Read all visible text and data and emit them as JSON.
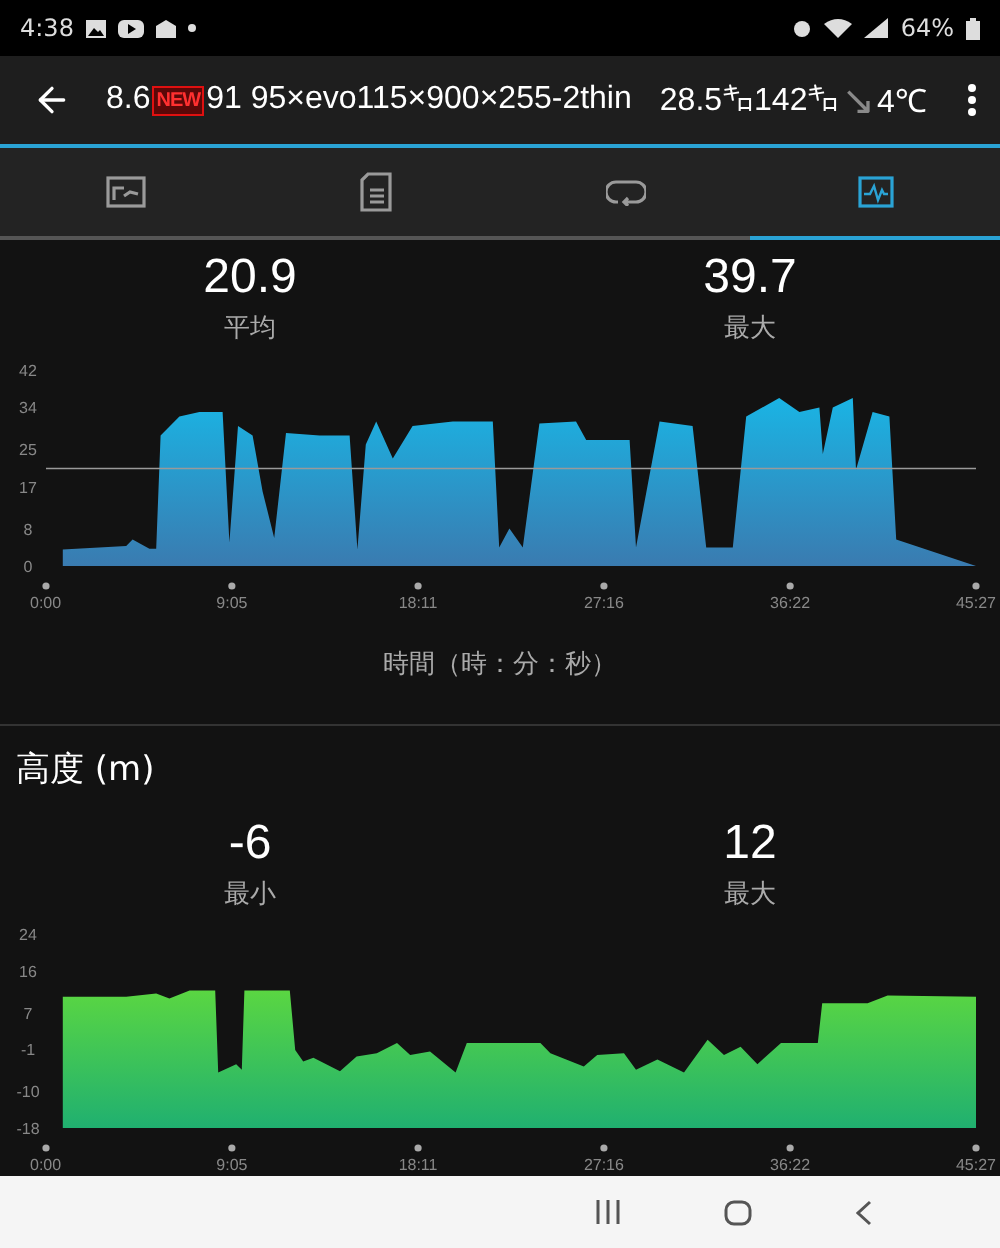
{
  "status_bar": {
    "time": "4:38",
    "battery": "64%"
  },
  "app_bar": {
    "title": [
      {
        "kind": "text",
        "text": "8.6"
      },
      {
        "kind": "badge",
        "text": "NEW"
      },
      {
        "kind": "text",
        "text": "91 95×evo115×900×255-2thin"
      },
      {
        "kind": "text",
        "text": "28.5㌔142㌔"
      },
      {
        "kind": "arrow",
        "text": "↘"
      },
      {
        "kind": "text",
        "text": "4℃"
      }
    ]
  },
  "tabs": [
    {
      "selected": false
    },
    {
      "selected": false
    },
    {
      "selected": false
    },
    {
      "selected": true
    }
  ],
  "speed": {
    "stats": [
      {
        "value": "20.9",
        "label": "平均"
      },
      {
        "value": "39.7",
        "label": "最大"
      }
    ],
    "chart_data": {
      "type": "area",
      "xlabel": "時間（時：分：秒）",
      "xlim": [
        0,
        2727
      ],
      "ylim": [
        0,
        42
      ],
      "yticks": [
        0,
        8,
        17,
        25,
        34,
        42
      ],
      "xticks": [
        {
          "value": 0,
          "label": "0:00"
        },
        {
          "value": 545,
          "label": "9:05"
        },
        {
          "value": 1091,
          "label": "18:11"
        },
        {
          "value": 1636,
          "label": "27:16"
        },
        {
          "value": 2182,
          "label": "36:22"
        },
        {
          "value": 2727,
          "label": "45:27"
        }
      ],
      "x": [
        49,
        235,
        254,
        303,
        323,
        336,
        391,
        450,
        518,
        538,
        563,
        606,
        635,
        669,
        704,
        802,
        890,
        913,
        938,
        968,
        1017,
        1075,
        1193,
        1310,
        1329,
        1359,
        1398,
        1447,
        1554,
        1584,
        1711,
        1730,
        1799,
        1896,
        1936,
        2014,
        2053,
        2150,
        2209,
        2268,
        2278,
        2307,
        2366,
        2375,
        2424,
        2473,
        2493,
        2727
      ],
      "series": [
        {
          "color": "#1ab4e4",
          "values": [
            3.5,
            4.3,
            5.7,
            3.7,
            3.7,
            28,
            32,
            33,
            33,
            5,
            30,
            28,
            16,
            6,
            28.5,
            28,
            28,
            3.5,
            26,
            31,
            23,
            30,
            31,
            31,
            4,
            8,
            4,
            30.5,
            31,
            27,
            27,
            4,
            31,
            30,
            4,
            4,
            32,
            36,
            33,
            34,
            24,
            34,
            36,
            20.6,
            33,
            32,
            5.7,
            0
          ]
        }
      ],
      "ref_lines": [
        {
          "axis": "y",
          "value": 20.9
        }
      ]
    }
  },
  "altitude": {
    "heading": "高度 (m)",
    "stats": [
      {
        "value": "-6",
        "label": "最小"
      },
      {
        "value": "12",
        "label": "最大"
      }
    ],
    "chart_data": {
      "type": "area",
      "xlim": [
        0,
        2727
      ],
      "ylim": [
        -18,
        24
      ],
      "yticks": [
        24,
        16,
        7,
        -1,
        -10,
        -18
      ],
      "xticks": [
        {
          "value": 0,
          "label": "0:00"
        },
        {
          "value": 545,
          "label": "9:05"
        },
        {
          "value": 1091,
          "label": "18:11"
        },
        {
          "value": 1636,
          "label": "27:16"
        },
        {
          "value": 2182,
          "label": "36:22"
        },
        {
          "value": 2727,
          "label": "45:27"
        }
      ],
      "x": [
        49,
        49,
        235,
        323,
        362,
        421,
        496,
        505,
        558,
        574,
        582,
        715,
        731,
        754,
        784,
        862,
        911,
        970,
        1029,
        1068,
        1126,
        1201,
        1234,
        1450,
        1479,
        1577,
        1616,
        1695,
        1730,
        1793,
        1871,
        1940,
        1988,
        2037,
        2086,
        2155,
        2263,
        2276,
        2409,
        2468,
        2727,
        2727
      ],
      "series": [
        {
          "color": "#5ad642",
          "values": [
            -18,
            10.4,
            10.4,
            11.1,
            10,
            11.8,
            11.8,
            -6,
            -4.2,
            -5.4,
            11.8,
            11.8,
            -1.1,
            -3.6,
            -2.8,
            -5.7,
            -2.5,
            -1.8,
            0.4,
            -2.2,
            -1.4,
            -6,
            0.4,
            0.4,
            -1.8,
            -4.7,
            -2.2,
            -1.8,
            -5.4,
            -3.2,
            -6,
            1.1,
            -2.2,
            -0.4,
            -4.2,
            0.4,
            0.4,
            9,
            9,
            10.7,
            10.4,
            -18
          ]
        }
      ]
    }
  }
}
